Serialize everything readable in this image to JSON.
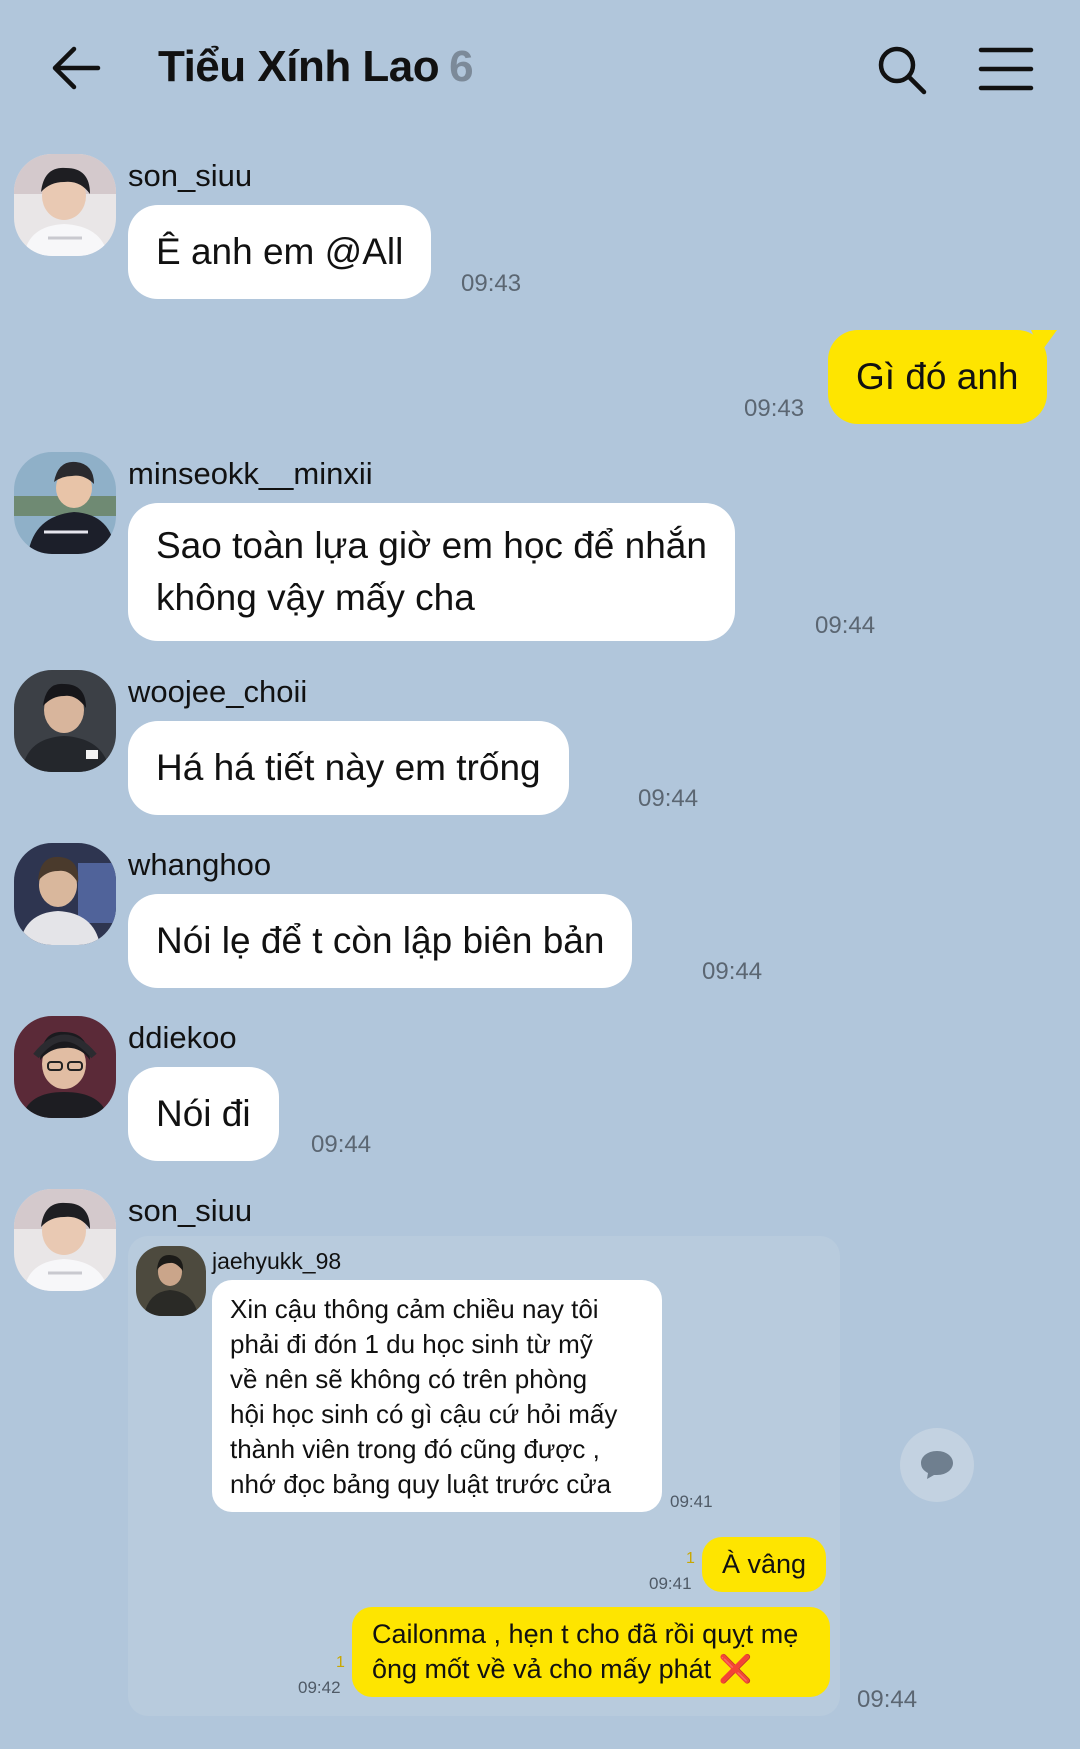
{
  "header": {
    "title": "Tiểu Xính Lao",
    "member_count": "6"
  },
  "messages": [
    {
      "sender": "son_siuu",
      "text": "Ê anh em @All",
      "time": "09:43"
    },
    {
      "sender": "me",
      "text": "Gì đó anh",
      "time": "09:43"
    },
    {
      "sender": "minseokk__minxii",
      "lines": [
        "Sao toàn lựa giờ em học để nhắn",
        "không vậy mấy cha"
      ],
      "time": "09:44"
    },
    {
      "sender": "woojee_choii",
      "text": "Há há tiết này em trống",
      "time": "09:44"
    },
    {
      "sender": "whanghoo",
      "text": "Nói lẹ để t còn lập biên bản",
      "time": "09:44"
    },
    {
      "sender": "ddiekoo",
      "text": "Nói đi",
      "time": "09:44"
    },
    {
      "sender": "son_siuu",
      "time": "09:44",
      "shared_image": {
        "sender": "jaehyukk_98",
        "lines": [
          "Xin cậu thông cảm chiều nay tôi",
          "phải đi đón 1 du học sinh từ mỹ",
          "về nên sẽ không có trên phòng",
          "hội học sinh có gì cậu cứ hỏi mấy",
          "thành viên trong đó cũng được ,",
          "nhớ đọc bảng quy luật trước cửa"
        ],
        "time": "09:41",
        "reply1": {
          "text": "À vâng",
          "time": "09:41",
          "unread": "1"
        },
        "reply2": {
          "lines": [
            "Cailonma , hẹn t cho đã rồi quỵt mẹ",
            "ông mốt về vả cho mấy phát"
          ],
          "emoji": "❌",
          "time": "09:42",
          "unread": "1"
        }
      }
    }
  ],
  "icons": {
    "back": "back-arrow-icon",
    "search": "search-icon",
    "menu": "menu-icon",
    "share": "share-chat-icon"
  },
  "colors": {
    "background": "#b1c6db",
    "my_bubble": "#fee500",
    "other_bubble": "#ffffff",
    "title_count": "#7c8a99"
  }
}
